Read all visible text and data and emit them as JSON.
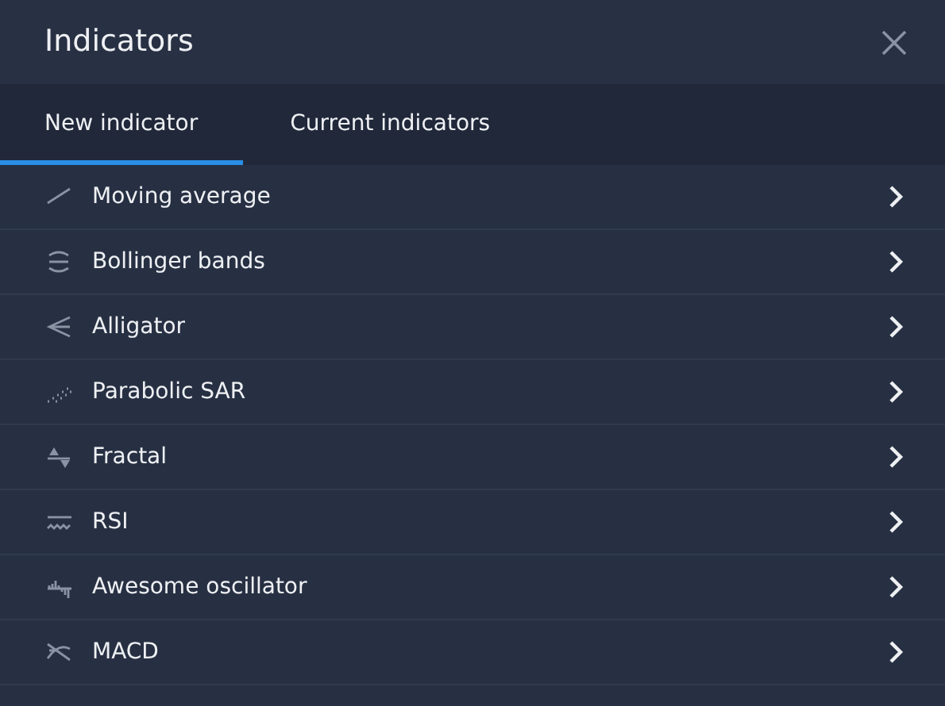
{
  "window": {
    "title": "Indicators"
  },
  "tabs": [
    {
      "label": "New indicator",
      "selected": true
    },
    {
      "label": "Current indicators",
      "selected": false
    }
  ],
  "items": [
    {
      "label": "Moving average",
      "kind": "line"
    },
    {
      "label": "Bollinger bands",
      "kind": "bands"
    },
    {
      "label": "Alligator",
      "kind": "alligator"
    },
    {
      "label": "Parabolic SAR",
      "kind": "dots"
    },
    {
      "label": "Fractal",
      "kind": "fractal"
    },
    {
      "label": "RSI",
      "kind": "rsi"
    },
    {
      "label": "Awesome oscillator",
      "kind": "bars"
    },
    {
      "label": "MACD",
      "kind": "macd"
    }
  ]
}
